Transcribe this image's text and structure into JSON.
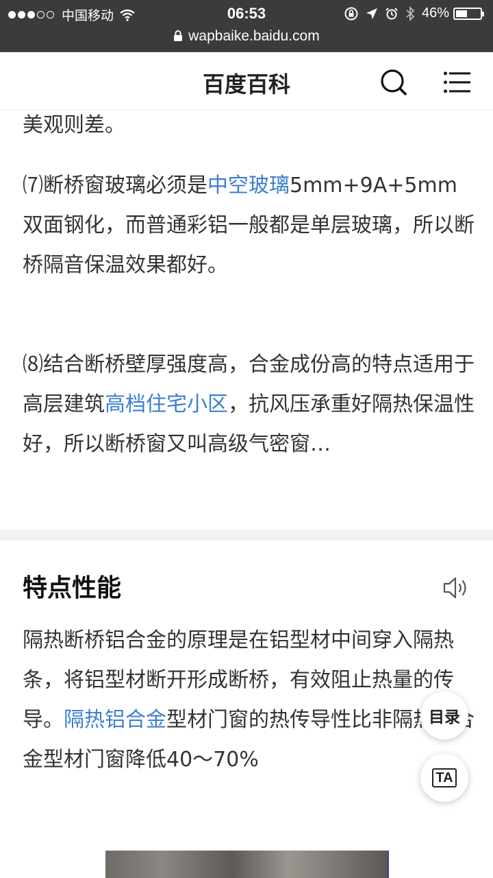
{
  "status_bar": {
    "carrier": "中国移动",
    "time": "06:53",
    "battery": "46%",
    "battery_level": 0.46,
    "signal_bars_filled": 3,
    "signal_bars_total": 5
  },
  "url_bar": {
    "url": "wapbaike.baidu.com"
  },
  "header": {
    "title": "百度百科",
    "icons": [
      "search-icon",
      "menu-icon"
    ]
  },
  "content": {
    "p0": {
      "text": "美观则差。"
    },
    "p7": {
      "prefix": "⑺断桥窗玻璃必须是",
      "link": "中空玻璃",
      "suffix": "5mm+9A+5mm双面钢化，而普通彩铝一般都是单层玻璃，所以断桥隔音保温效果都好。"
    },
    "p8": {
      "prefix": "⑻结合断桥壁厚强度高，合金成份高的特点适用于高层建筑",
      "link": "高档住宅小区",
      "suffix": "，抗风压承重好隔热保温性好，所以断桥窗又叫高级气密窗…"
    }
  },
  "section": {
    "title": "特点性能",
    "speaker_icon": "speaker-icon",
    "para": {
      "prefix": "隔热断桥铝合金的原理是在铝型材中间穿入隔热条，将铝型材断开形成断桥，有效阻止热量的传导。",
      "link": "隔热铝合金",
      "suffix": "型材门窗的热传导性比非隔热铝合金型材门窗降低40～70%"
    }
  },
  "floating": {
    "toc_label": "目录",
    "ta_label": "TA"
  },
  "colors": {
    "link": "#3b7fd1",
    "status_bg": "#3b3b3b",
    "text": "#333333"
  }
}
